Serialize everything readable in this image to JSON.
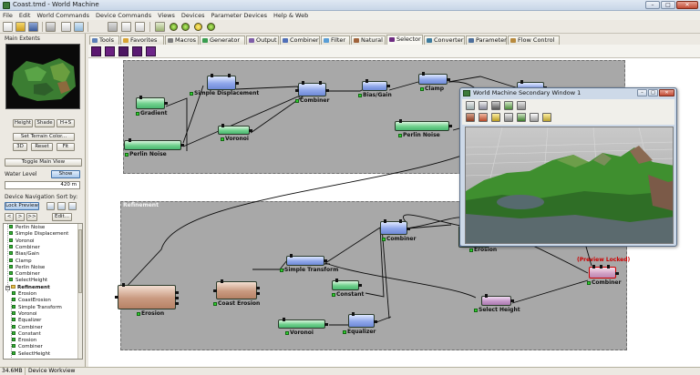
{
  "window": {
    "title": "Coast.tmd - World Machine"
  },
  "menu": [
    "File",
    "Edit",
    "World Commands",
    "Device Commands",
    "Views",
    "Devices",
    "Parameter Devices",
    "Help & Web"
  ],
  "toolbar": {
    "icons": [
      "new-file-icon",
      "open-folder-icon",
      "save-icon",
      "print-icon",
      "build-icon",
      "select-tool-icon",
      "grid-tool-icon",
      "tiles-icon",
      "build-green-dot-icon",
      "build-green-dot-2-icon",
      "build-yellow-dot-icon",
      "build-green-dot-3-icon"
    ]
  },
  "left_panel": {
    "main_extents_label": "Main Extents",
    "view_buttons": [
      "Height",
      "Shade",
      "H+S"
    ],
    "set_terrain_color": "Set Terrain Color...",
    "action_buttons": [
      "3D",
      "Reset",
      "Fit"
    ],
    "toggle_main_view": "Toggle Main View",
    "water_level_label": "Water Level",
    "show_button": "Show",
    "water_value": "420 m",
    "device_navigation_label": "Device Navigation",
    "sort_by_label": "Sort by:",
    "lock_preview": "Lock Preview",
    "nav_buttons": [
      "<",
      ">",
      ">>"
    ],
    "edit_button": "Edit...",
    "tree": [
      {
        "label": "Perlin Noise",
        "type": "item"
      },
      {
        "label": "Simple Displacement",
        "type": "item"
      },
      {
        "label": "Voronoi",
        "type": "item"
      },
      {
        "label": "Combiner",
        "type": "item"
      },
      {
        "label": "Bias/Gain",
        "type": "item"
      },
      {
        "label": "Clamp",
        "type": "item"
      },
      {
        "label": "Perlin Noise",
        "type": "item"
      },
      {
        "label": "Combiner",
        "type": "item"
      },
      {
        "label": "SelectHeight",
        "type": "item"
      },
      {
        "label": "Refinement",
        "type": "group"
      },
      {
        "label": "Erosion",
        "type": "item"
      },
      {
        "label": "CoastErosion",
        "type": "item"
      },
      {
        "label": "Simple Transform",
        "type": "item"
      },
      {
        "label": "Voronoi",
        "type": "item"
      },
      {
        "label": "Equalizer",
        "type": "item"
      },
      {
        "label": "Combiner",
        "type": "item"
      },
      {
        "label": "Constant",
        "type": "item"
      },
      {
        "label": "Erosion",
        "type": "item"
      },
      {
        "label": "Combiner",
        "type": "item"
      },
      {
        "label": "SelectHeight",
        "type": "item"
      }
    ]
  },
  "tabs": [
    {
      "label": "Tools",
      "icon": "tools-icon",
      "color": "#5b7fb8"
    },
    {
      "label": "Favorites",
      "icon": "favorites-icon",
      "color": "#d8a334"
    },
    {
      "label": "Macros",
      "icon": "macros-icon",
      "color": "#7d7d7d"
    },
    {
      "label": "Generator",
      "icon": "generator-icon",
      "color": "#3a9d50"
    },
    {
      "label": "Output",
      "icon": "output-icon",
      "color": "#7f5ea8"
    },
    {
      "label": "Combiner",
      "icon": "combiner-icon",
      "color": "#5170b8"
    },
    {
      "label": "Filter",
      "icon": "filter-icon",
      "color": "#5a9ed6"
    },
    {
      "label": "Natural",
      "icon": "natural-icon",
      "color": "#a0633b"
    },
    {
      "label": "Selector",
      "icon": "selector-icon",
      "color": "#6d2b82"
    },
    {
      "label": "Converter",
      "icon": "converter-icon",
      "color": "#3e7b9d"
    },
    {
      "label": "Parameter",
      "icon": "parameter-icon",
      "color": "#4e6f9b"
    },
    {
      "label": "Flow Control",
      "icon": "flow-control-icon",
      "color": "#b88a3d"
    }
  ],
  "active_tab": "Selector",
  "subtoolbar_icons": [
    "select-height-icon",
    "select-slope-icon",
    "select-convexity-icon",
    "select-direction-icon"
  ],
  "workview": {
    "group_refinement_label": "Refinement",
    "preview_locked": "(Preview Locked)",
    "nodes": {
      "gradient": "Gradient",
      "perlin1": "Perlin Noise",
      "simpledisp": "Simple Displacement",
      "voronoi1": "Voronoi",
      "combiner1": "Combiner",
      "biasgain": "Bias/Gain",
      "clamp": "Clamp",
      "perlin2": "Perlin Noise",
      "erosion1": "Erosion",
      "coasterosion": "Coast Erosion",
      "simpletransform": "Simple Transform",
      "constant": "Constant",
      "voronoi2": "Voronoi",
      "equalizer": "Equalizer",
      "combiner2": "Combiner",
      "erosion2": "Erosion",
      "selectheight": "Select Height",
      "combiner3": "Combiner"
    }
  },
  "secondary_window": {
    "title": "World Machine Secondary Window 1",
    "tool_icons": [
      "layout-icon",
      "layout-2-icon",
      "camera-icon",
      "landscape-icon",
      "terrain-icon",
      "rotate-icon",
      "export-icon",
      "render-icon",
      "fit-icon",
      "texture-icon",
      "lock-icon",
      "settings-icon"
    ]
  },
  "status": {
    "memory": "34.6MB",
    "view": "Device Workview"
  }
}
